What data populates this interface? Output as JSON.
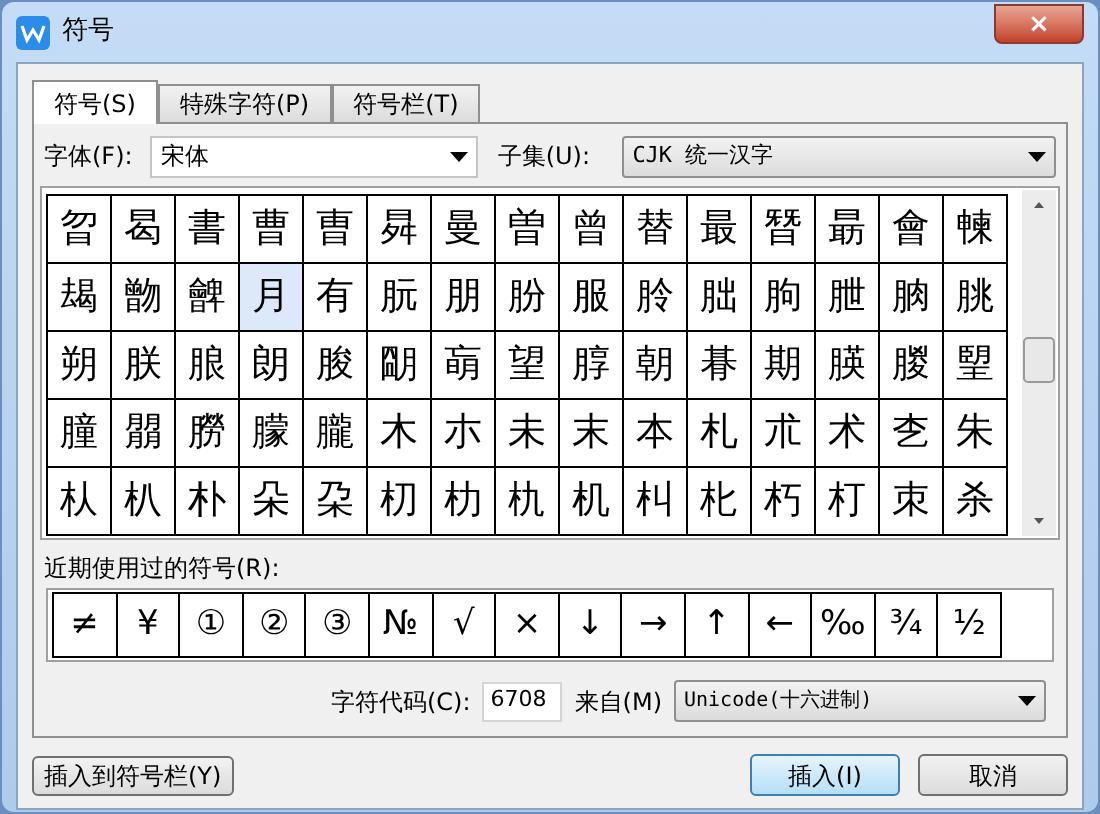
{
  "window": {
    "title": "符号",
    "close": "×"
  },
  "tabs": [
    {
      "label": "符号(S)",
      "selected": true
    },
    {
      "label": "特殊字符(P)",
      "selected": false
    },
    {
      "label": "符号栏(T)",
      "selected": false
    }
  ],
  "font": {
    "label": "字体(F):",
    "value": "宋体"
  },
  "subset": {
    "label": "子集(U):",
    "value": "CJK 统一汉字"
  },
  "grid": [
    [
      {
        "char": "曶",
        "selected": false
      },
      {
        "char": "曷",
        "selected": false
      },
      {
        "char": "書",
        "selected": false
      },
      {
        "char": "曹",
        "selected": false
      },
      {
        "char": "曺",
        "selected": false
      },
      {
        "char": "曻",
        "selected": false
      },
      {
        "char": "曼",
        "selected": false
      },
      {
        "char": "曽",
        "selected": false
      },
      {
        "char": "曾",
        "selected": false
      },
      {
        "char": "替",
        "selected": false
      },
      {
        "char": "最",
        "selected": false
      },
      {
        "char": "朁",
        "selected": false
      },
      {
        "char": "朂",
        "selected": false
      },
      {
        "char": "會",
        "selected": false
      },
      {
        "char": "朄",
        "selected": false
      }
    ],
    [
      {
        "char": "朅",
        "selected": false
      },
      {
        "char": "朆",
        "selected": false
      },
      {
        "char": "朇",
        "selected": false
      },
      {
        "char": "月",
        "selected": true
      },
      {
        "char": "有",
        "selected": false
      },
      {
        "char": "朊",
        "selected": false
      },
      {
        "char": "朋",
        "selected": false
      },
      {
        "char": "朌",
        "selected": false
      },
      {
        "char": "服",
        "selected": false
      },
      {
        "char": "朎",
        "selected": false
      },
      {
        "char": "朏",
        "selected": false
      },
      {
        "char": "朐",
        "selected": false
      },
      {
        "char": "朑",
        "selected": false
      },
      {
        "char": "朒",
        "selected": false
      },
      {
        "char": "朓",
        "selected": false
      }
    ],
    [
      {
        "char": "朔",
        "selected": false
      },
      {
        "char": "朕",
        "selected": false
      },
      {
        "char": "朖",
        "selected": false
      },
      {
        "char": "朗",
        "selected": false
      },
      {
        "char": "朘",
        "selected": false
      },
      {
        "char": "朙",
        "selected": false
      },
      {
        "char": "朚",
        "selected": false
      },
      {
        "char": "望",
        "selected": false
      },
      {
        "char": "朜",
        "selected": false
      },
      {
        "char": "朝",
        "selected": false
      },
      {
        "char": "朞",
        "selected": false
      },
      {
        "char": "期",
        "selected": false
      },
      {
        "char": "朠",
        "selected": false
      },
      {
        "char": "朡",
        "selected": false
      },
      {
        "char": "朢",
        "selected": false
      }
    ],
    [
      {
        "char": "朣",
        "selected": false
      },
      {
        "char": "朤",
        "selected": false
      },
      {
        "char": "朥",
        "selected": false
      },
      {
        "char": "朦",
        "selected": false
      },
      {
        "char": "朧",
        "selected": false
      },
      {
        "char": "木",
        "selected": false
      },
      {
        "char": "朩",
        "selected": false
      },
      {
        "char": "未",
        "selected": false
      },
      {
        "char": "末",
        "selected": false
      },
      {
        "char": "本",
        "selected": false
      },
      {
        "char": "札",
        "selected": false
      },
      {
        "char": "朮",
        "selected": false
      },
      {
        "char": "术",
        "selected": false
      },
      {
        "char": "朰",
        "selected": false
      },
      {
        "char": "朱",
        "selected": false
      }
    ],
    [
      {
        "char": "朲",
        "selected": false
      },
      {
        "char": "朳",
        "selected": false
      },
      {
        "char": "朴",
        "selected": false
      },
      {
        "char": "朵",
        "selected": false
      },
      {
        "char": "朶",
        "selected": false
      },
      {
        "char": "朷",
        "selected": false
      },
      {
        "char": "朸",
        "selected": false
      },
      {
        "char": "朹",
        "selected": false
      },
      {
        "char": "机",
        "selected": false
      },
      {
        "char": "朻",
        "selected": false
      },
      {
        "char": "朼",
        "selected": false
      },
      {
        "char": "朽",
        "selected": false
      },
      {
        "char": "朾",
        "selected": false
      },
      {
        "char": "朿",
        "selected": false
      },
      {
        "char": "杀",
        "selected": false
      }
    ]
  ],
  "recent": {
    "label": "近期使用过的符号(R):",
    "symbols": [
      "≠",
      "¥",
      "①",
      "②",
      "③",
      "№",
      "√",
      "×",
      "↓",
      "→",
      "↑",
      "←",
      "‰",
      "¾",
      "½"
    ]
  },
  "code": {
    "label": "字符代码(C):",
    "value": "6708",
    "from_label": "来自(M)",
    "from_value": "Unicode(十六进制)"
  },
  "buttons": {
    "add_to_bar": "插入到符号栏(Y)",
    "insert": "插入(I)",
    "cancel": "取消"
  }
}
